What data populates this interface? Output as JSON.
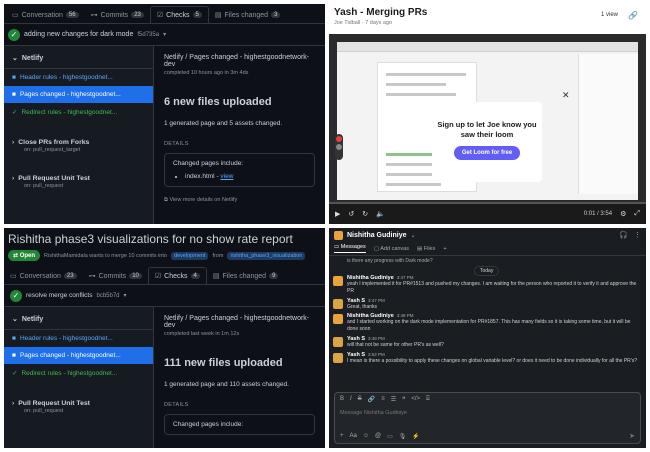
{
  "p1": {
    "tabs": [
      {
        "label": "Conversation",
        "count": "56"
      },
      {
        "label": "Commits",
        "count": "23"
      },
      {
        "label": "Checks",
        "count": "5"
      },
      {
        "label": "Files changed",
        "count": "3"
      }
    ],
    "commit_msg": "adding new changes for dark mode",
    "commit_sha": "f5d735a",
    "side_head": "Netlify",
    "side_items": [
      "Header rules - highestgoodnet...",
      "Pages changed - highestgoodnet...",
      "Redirect rules - highestgoodnet..."
    ],
    "groups": [
      {
        "name": "Close PRs from Forks",
        "sub": "on: pull_request_target"
      },
      {
        "name": "Pull Request Unit Test",
        "sub": "on: pull_request"
      }
    ],
    "main_title": "Netlify / Pages changed - highestgoodnetwork-dev",
    "main_sub": "completed 10 hours ago in 3m 4ds",
    "big": "6 new files uploaded",
    "desc": "1 generated page and 5 assets changed.",
    "details": "DETAILS",
    "changed_label": "Changed pages include:",
    "file_name": "index.html",
    "sep": "-",
    "view": "view",
    "more": "View more details on Netlify"
  },
  "p2": {
    "title": "Yash - Merging PRs",
    "author": "Joe Tidball",
    "ago": "7 days ago",
    "views": "1 view",
    "cta_text": "Sign up to let Joe know you saw their loom",
    "cta_button": "Get Loom for free",
    "time": "0:01 / 3:54"
  },
  "p3": {
    "title": "Rishitha phase3 visualizations for no show rate report",
    "open": "Open",
    "status": "RishithaMamidala wants to merge 10 commits into",
    "base": "development",
    "from": "from",
    "head": "rishitha_phase3_visualization",
    "tabs": [
      {
        "label": "Conversation",
        "count": "23"
      },
      {
        "label": "Commits",
        "count": "10"
      },
      {
        "label": "Checks",
        "count": "4"
      },
      {
        "label": "Files changed",
        "count": "9"
      }
    ],
    "commit_msg": "resolve merge conflicts",
    "commit_sha": "bcb5b7d",
    "side_head": "Netlify",
    "side_items": [
      "Header rules - highestgoodnet...",
      "Pages changed - highestgoodnet...",
      "Redirect rules - highestgoodnet..."
    ],
    "groups": [
      {
        "name": "Pull Request Unit Test",
        "sub": "on: pull_request"
      }
    ],
    "main_title": "Netlify / Pages changed - highestgoodnetwork-dev",
    "main_sub": "completed last week in 1m 12s",
    "big": "111 new files uploaded",
    "desc": "1 generated page and 110 assets changed.",
    "details": "DETAILS",
    "changed_label": "Changed pages include:"
  },
  "p4": {
    "name": "Nishitha Gudiniye",
    "tabs": [
      "Messages",
      "Add canvas",
      "Files"
    ],
    "top_msg": "is there any progress with Dark mode?",
    "day": "Today",
    "messages": [
      {
        "who": "Nishitha Gudiniye",
        "time": "3:47 PM",
        "text": "yeah I implemented it for PR#1513 and pushed my changes. I am waiting for the person who reported it to verify it and approve the PR"
      },
      {
        "who": "Yash S",
        "time": "3:47 PM",
        "text": "Great, thanks"
      },
      {
        "who": "Nishitha Gudiniye",
        "time": "3:48 PM",
        "text": "and I started working on the dark mode implementation for PR#1857. This has many fields so it is taking some time, but it will be done soon"
      },
      {
        "who": "Yash S",
        "time": "3:48 PM",
        "text": "will that not be same for other PR's as well?"
      },
      {
        "who": "Yash S",
        "time": "3:52 PM",
        "text": "I mean is there a possibility to apply these changes on global variable level? or does it need to be done individually for all the PR's?"
      }
    ],
    "placeholder": "Message Nishitha Gudiniye"
  }
}
